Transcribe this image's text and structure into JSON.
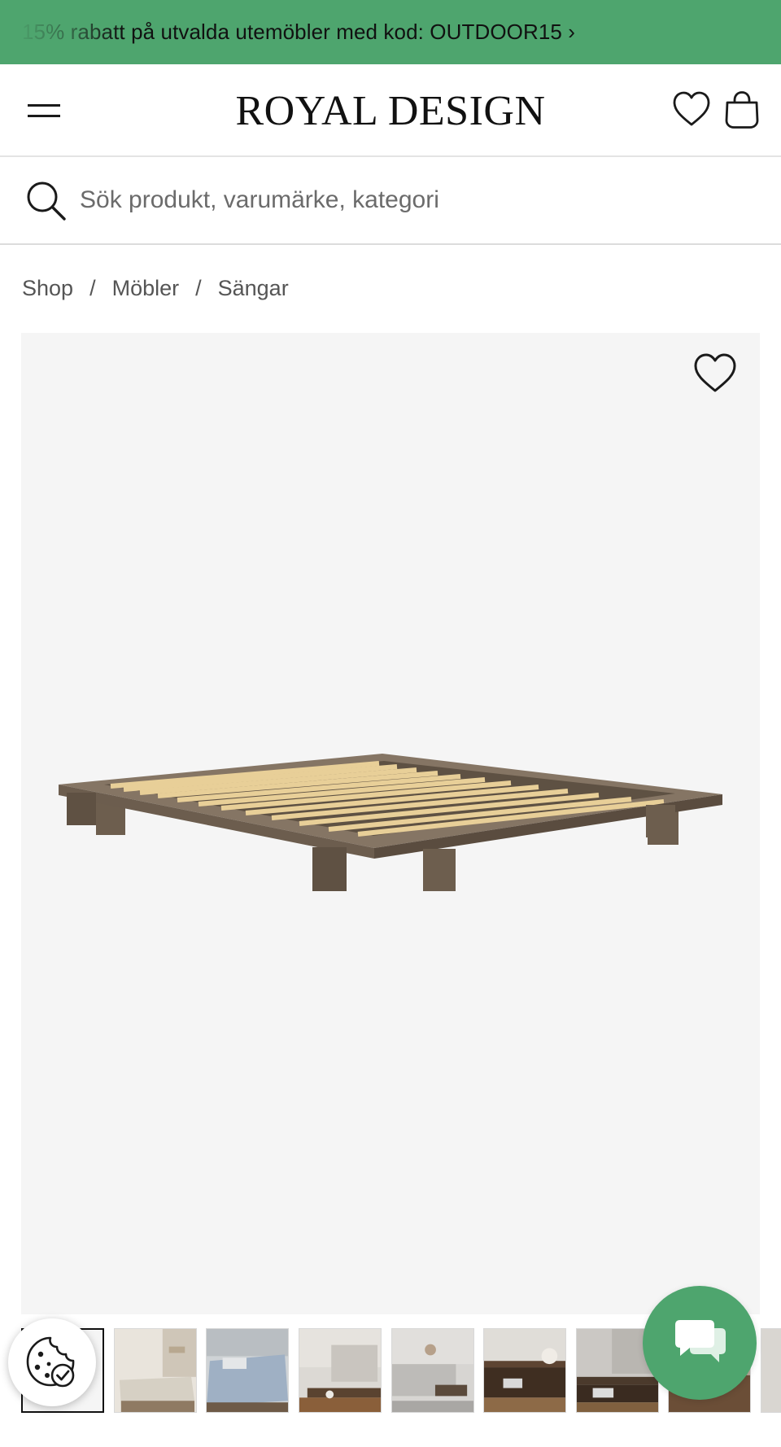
{
  "promo": {
    "text": "15% rabatt på utvalda utemöbler med kod: OUTDOOR15 ›"
  },
  "header": {
    "logo": "ROYAL DESIGN",
    "icons": [
      "menu-icon",
      "heart-icon",
      "shopping-bag-icon"
    ]
  },
  "search": {
    "placeholder": "Sök produkt, varumärke, kategori",
    "value": ""
  },
  "breadcrumb": {
    "items": [
      "Shop",
      "Möbler",
      "Sängar"
    ],
    "separator": "/"
  },
  "gallery": {
    "favorite_icon": "heart-icon",
    "thumbnail_count": 9,
    "active_thumbnail": 1
  },
  "floating": {
    "cookie_icon": "cookie-icon",
    "chat_icon": "chat-icon"
  },
  "colors": {
    "brand_green": "#4ea56e",
    "gallery_bg": "#f5f5f5",
    "text": "#1a1a1a"
  }
}
